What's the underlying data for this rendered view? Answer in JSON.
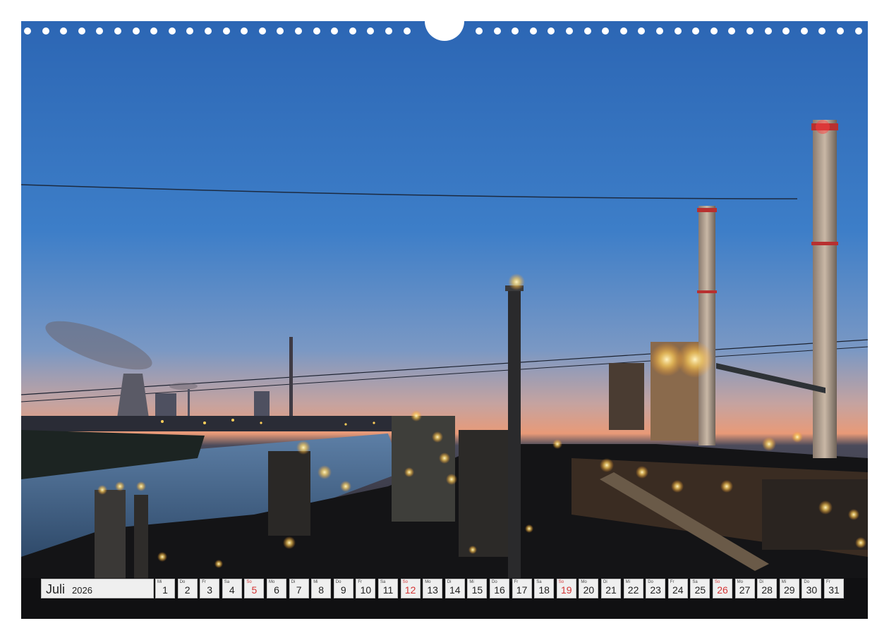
{
  "calendar": {
    "month": "Juli",
    "year": "2026",
    "days": [
      {
        "wd": "Mi",
        "n": "1"
      },
      {
        "wd": "Do",
        "n": "2"
      },
      {
        "wd": "Fr",
        "n": "3"
      },
      {
        "wd": "Sa",
        "n": "4"
      },
      {
        "wd": "So",
        "n": "5",
        "sunday": true
      },
      {
        "wd": "Mo",
        "n": "6"
      },
      {
        "wd": "Di",
        "n": "7"
      },
      {
        "wd": "Mi",
        "n": "8"
      },
      {
        "wd": "Do",
        "n": "9"
      },
      {
        "wd": "Fr",
        "n": "10"
      },
      {
        "wd": "Sa",
        "n": "11"
      },
      {
        "wd": "So",
        "n": "12",
        "sunday": true
      },
      {
        "wd": "Mo",
        "n": "13"
      },
      {
        "wd": "Di",
        "n": "14"
      },
      {
        "wd": "Mi",
        "n": "15"
      },
      {
        "wd": "Do",
        "n": "16"
      },
      {
        "wd": "Fr",
        "n": "17"
      },
      {
        "wd": "Sa",
        "n": "18"
      },
      {
        "wd": "So",
        "n": "19",
        "sunday": true
      },
      {
        "wd": "Mo",
        "n": "20"
      },
      {
        "wd": "Di",
        "n": "21"
      },
      {
        "wd": "Mi",
        "n": "22"
      },
      {
        "wd": "Do",
        "n": "23"
      },
      {
        "wd": "Fr",
        "n": "24"
      },
      {
        "wd": "Sa",
        "n": "25"
      },
      {
        "wd": "So",
        "n": "26",
        "sunday": true
      },
      {
        "wd": "Mo",
        "n": "27"
      },
      {
        "wd": "Di",
        "n": "28"
      },
      {
        "wd": "Mi",
        "n": "29"
      },
      {
        "wd": "Do",
        "n": "30"
      },
      {
        "wd": "Fr",
        "n": "31"
      }
    ]
  },
  "colors": {
    "sky_top": "#2c66b4",
    "sky_horizon": "#e89a78",
    "sunday_red": "#d43535",
    "light_glow": "#ffcf5a"
  }
}
